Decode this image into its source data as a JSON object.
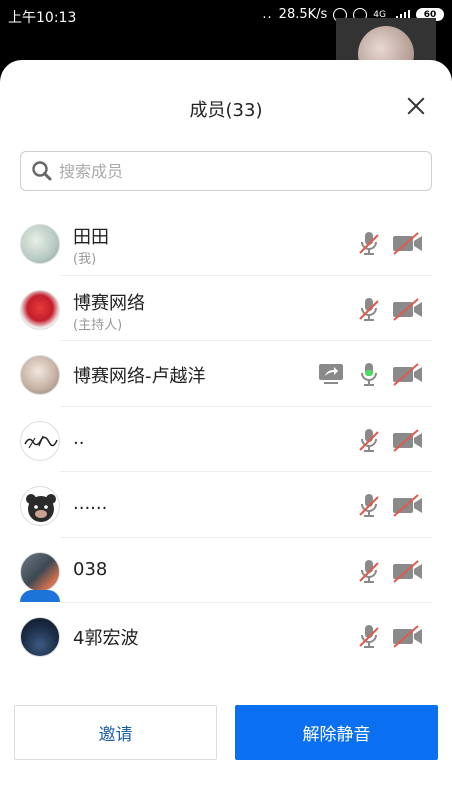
{
  "status_bar": {
    "time": "上午10:13",
    "speed": "28.5K/s",
    "network": "4G",
    "battery": "60"
  },
  "panel": {
    "title": "成员(33)",
    "close_icon": "close-icon"
  },
  "search": {
    "placeholder": "搜索成员",
    "value": ""
  },
  "members": [
    {
      "name": "田田",
      "role": "(我)",
      "mic": "muted",
      "camera": "off",
      "sharing": false
    },
    {
      "name": "博赛网络",
      "role": "(主持人)",
      "mic": "muted",
      "camera": "off",
      "sharing": false
    },
    {
      "name": "博赛网络-卢越洋",
      "role": "",
      "mic": "active",
      "camera": "off",
      "sharing": true
    },
    {
      "name": "..",
      "role": "",
      "mic": "muted",
      "camera": "off",
      "sharing": false
    },
    {
      "name": "......",
      "role": "",
      "mic": "muted",
      "camera": "off",
      "sharing": false
    },
    {
      "name": "038",
      "role": "",
      "mic": "muted",
      "camera": "off",
      "sharing": false
    },
    {
      "name": "4郭宏波",
      "role": "",
      "mic": "muted",
      "camera": "off",
      "sharing": false
    }
  ],
  "buttons": {
    "invite": "邀请",
    "unmute_all": "解除静音"
  },
  "colors": {
    "accent": "#0a6ff0",
    "invite_text": "#1f5fa8",
    "muted_red": "#e05a4e",
    "active_green": "#4cd964",
    "icon_gray": "#8a8a8a"
  }
}
